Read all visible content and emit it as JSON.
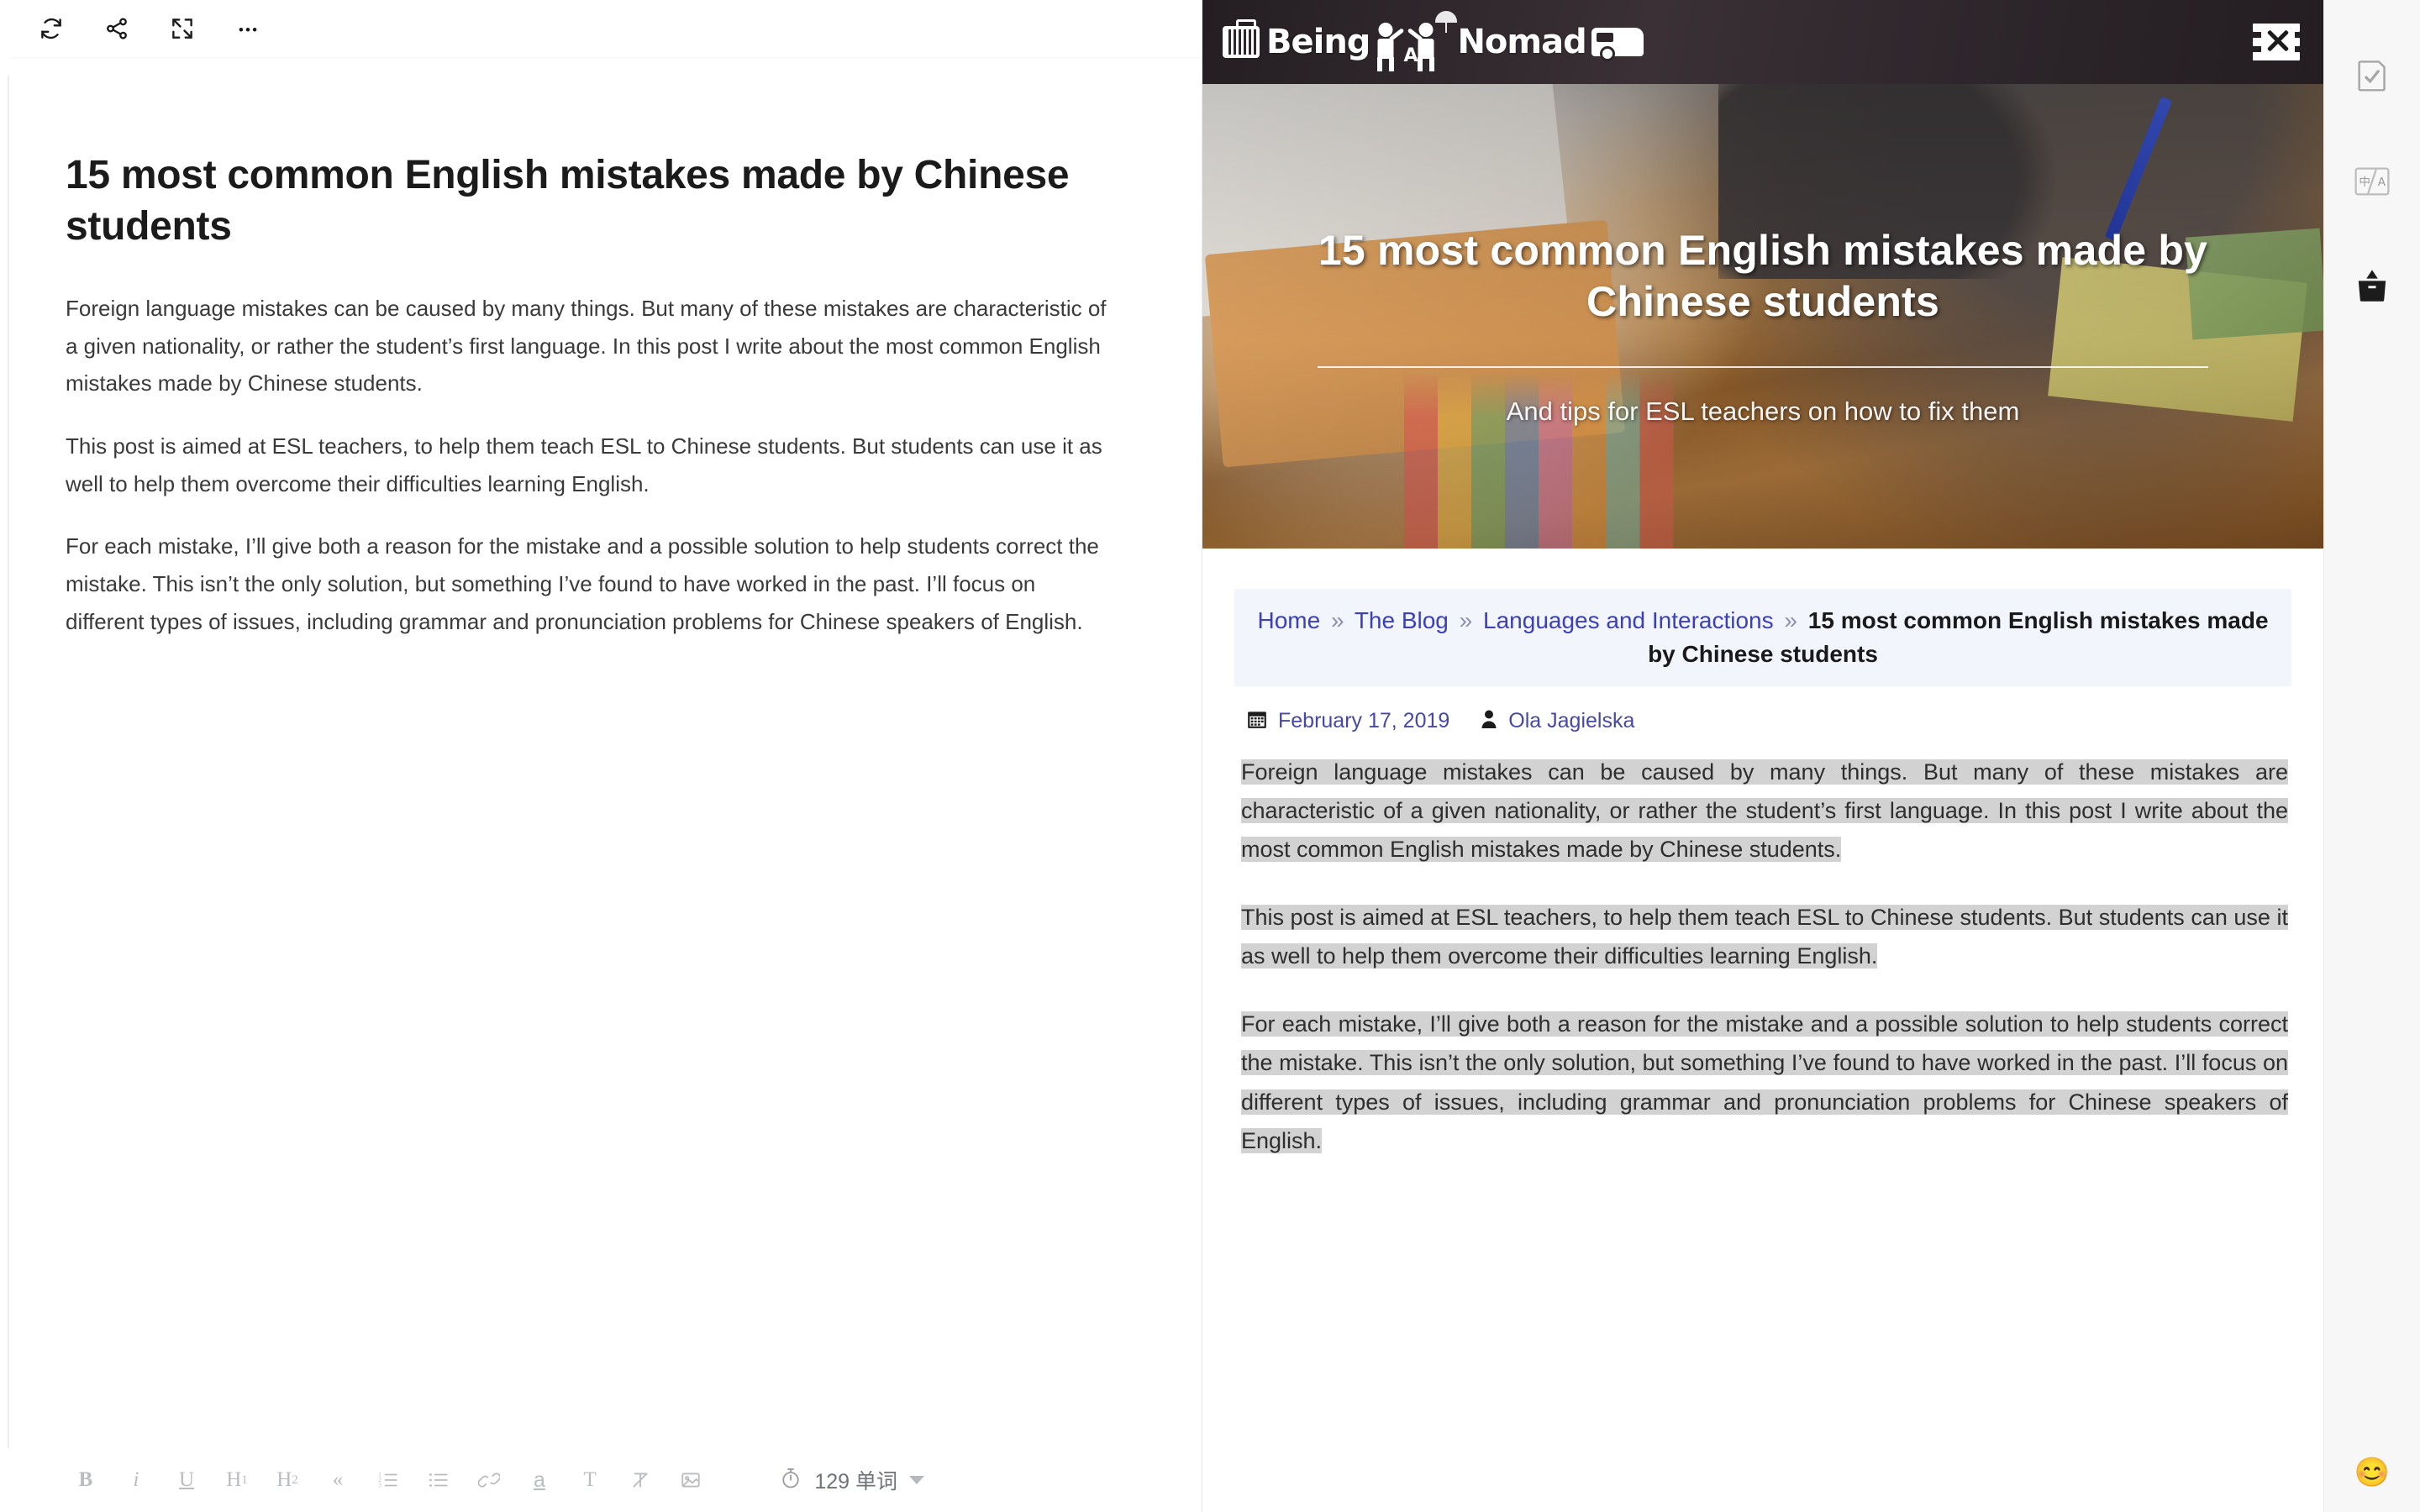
{
  "editor": {
    "toolbar_top": [
      {
        "name": "refresh-icon",
        "label": "Refresh"
      },
      {
        "name": "share-icon",
        "label": "Share"
      },
      {
        "name": "fullscreen-icon",
        "label": "Fullscreen"
      },
      {
        "name": "more-options-icon",
        "label": "More"
      }
    ],
    "title": "15 most common English mistakes made by Chinese students",
    "paragraphs": [
      "Foreign language mistakes can be caused by many things. But many of these mistakes are characteristic of a given nationality, or rather the student’s first language. In this post I write about the most common English mistakes made by Chinese students.",
      "This post is aimed at ESL teachers, to help them teach ESL to Chinese students. But students can use it as well to help them overcome their difficulties learning English.",
      "For each mistake, I’ll give both a reason for the mistake and a possible solution to help students correct the mistake. This isn’t the only solution, but something I’ve found to have worked in the past. I’ll focus on different types of issues, including grammar and pronunciation problems for Chinese speakers of English."
    ],
    "format_toolbar": [
      {
        "name": "bold-button",
        "label": "B"
      },
      {
        "name": "italic-button",
        "label": "i"
      },
      {
        "name": "underline-button",
        "label": "U"
      },
      {
        "name": "heading-1-button",
        "label": "H",
        "sub": "1"
      },
      {
        "name": "heading-2-button",
        "label": "H",
        "sub": "2"
      },
      {
        "name": "blockquote-button",
        "label": "«"
      },
      {
        "name": "ordered-list-button",
        "label": ""
      },
      {
        "name": "unordered-list-button",
        "label": ""
      },
      {
        "name": "link-button",
        "label": ""
      },
      {
        "name": "text-color-button",
        "label": "a"
      },
      {
        "name": "font-button",
        "label": "T"
      },
      {
        "name": "clear-format-button",
        "label": ""
      },
      {
        "name": "insert-image-button",
        "label": ""
      }
    ],
    "status": {
      "timer_icon": "stopwatch-icon",
      "word_count": "129 单词"
    }
  },
  "preview": {
    "site": {
      "logo_text_1": "Being",
      "logo_text_A": "A",
      "logo_text_2": "Nomad",
      "menu_icon": "hamburger-close-icon"
    },
    "hero": {
      "title": "15 most common English mistakes made by Chinese students",
      "subtitle": "And tips for ESL teachers on how to fix them"
    },
    "breadcrumb": {
      "items": [
        {
          "label": "Home",
          "link": true
        },
        {
          "label": "The Blog",
          "link": true
        },
        {
          "label": "Languages and Interactions",
          "link": true
        }
      ],
      "separator": "»",
      "current": "15 most common English mistakes made by Chinese students"
    },
    "meta": {
      "date_icon": "calendar-icon",
      "date": "February 17, 2019",
      "author_icon": "user-icon",
      "author": "Ola Jagielska"
    },
    "paragraphs": [
      "Foreign language mistakes can be caused by many things. But many of these mistakes are characteristic of a given nationality, or rather the student’s first language. In this post I write about the most common English mistakes made by Chinese students.",
      "This post is aimed at ESL teachers, to help them teach ESL to Chinese students. But students can use it as well to help them overcome their difficulties learning English.",
      "For each mistake, I’ll give both a reason for the mistake and a possible solution to help students correct the mistake. This isn’t the only solution, but something I’ve found to have worked in the past. I’ll focus on different types of issues, including grammar and pronunciation problems for Chinese speakers of English."
    ]
  },
  "tool_sidebar": {
    "items": [
      {
        "name": "proofread-icon",
        "label": "Proofread"
      },
      {
        "name": "translate-icon",
        "label": "Translate"
      },
      {
        "name": "archive-icon",
        "label": "Collect"
      }
    ],
    "emoji": "😊"
  },
  "colors": {
    "header_bg": "#2e262b",
    "breadcrumb_bg": "#f2f5fb",
    "link": "#3b3fb8",
    "selection": "#d2d2d2",
    "sidebar_bg": "#f7f7f7"
  }
}
